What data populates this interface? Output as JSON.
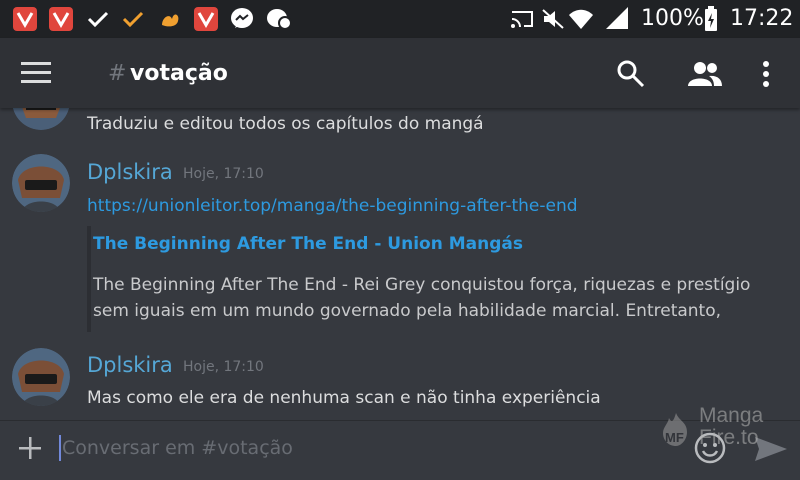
{
  "status_bar": {
    "battery": "100%",
    "time": "17:22",
    "notification_icons": [
      "vivaldi-icon",
      "vivaldi-icon",
      "check-icon",
      "check-icon",
      "uc-browser-icon",
      "vivaldi-icon",
      "messenger-icon",
      "chat-bubble-icon"
    ],
    "system_icons": [
      "cast-icon",
      "mute-icon",
      "wifi-icon",
      "signal-icon",
      "battery-charging-icon"
    ]
  },
  "app_bar": {
    "hash": "#",
    "channel": "votação",
    "icons": [
      "menu-icon",
      "search-icon",
      "members-icon",
      "more-vert-icon"
    ]
  },
  "messages": [
    {
      "text": "Traduziu e editou todos os capítulos do mangá"
    },
    {
      "author": "Dplskira",
      "timestamp": "Hoje, 17:10",
      "link": "https://unionleitor.top/manga/the-beginning-after-the-end",
      "embed": {
        "title": "The Beginning After The End - Union Mangás",
        "description_lines": [
          "The Beginning After The End - Rei Grey conquistou força, riquezas e prestígio",
          "sem iguais em um mundo governado pela habilidade marcial. Entretanto,"
        ]
      }
    },
    {
      "author": "Dplskira",
      "timestamp": "Hoje, 17:10",
      "text": "Mas como ele era de nenhuma scan e não tinha experiência"
    }
  ],
  "composer": {
    "placeholder": "Conversar em #votação",
    "icons": [
      "add-icon",
      "emoji-icon",
      "send-icon"
    ]
  },
  "watermark": {
    "line1": "Manga",
    "line2": "Fire.to",
    "badge": "MF"
  },
  "colors": {
    "background": "#36393f",
    "app_bar": "#2f3136",
    "status_bar": "#202225",
    "username": "#55a7d6",
    "link": "#2d9ae0",
    "text": "#dcddde",
    "muted": "#72767d"
  }
}
